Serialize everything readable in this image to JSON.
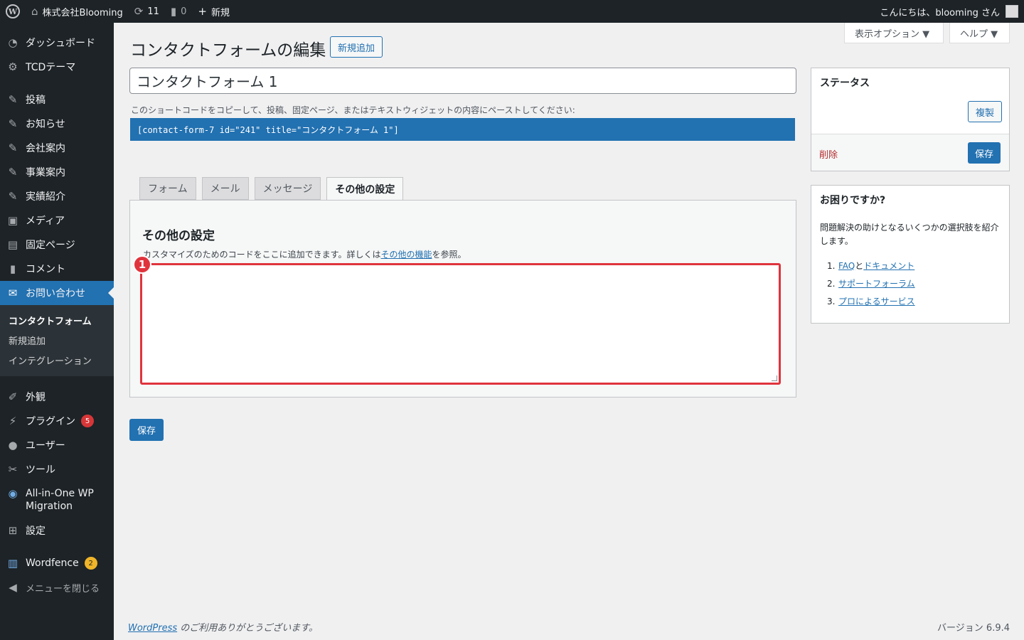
{
  "adminbar": {
    "site_name": "株式会社Blooming",
    "updates_count": "11",
    "comments_count": "0",
    "new_label": "新規",
    "greeting": "こんにちは、blooming さん"
  },
  "screen_options": {
    "display_options": "表示オプション ▼",
    "help": "ヘルプ ▼"
  },
  "sidebar": {
    "items": [
      {
        "label": "ダッシュボード",
        "icon": "dashboard-icon"
      },
      {
        "label": "TCDテーマ",
        "icon": "gear-icon"
      },
      {
        "label": "投稿",
        "icon": "pin-icon"
      },
      {
        "label": "お知らせ",
        "icon": "pin-icon"
      },
      {
        "label": "会社案内",
        "icon": "pin-icon"
      },
      {
        "label": "事業案内",
        "icon": "pin-icon"
      },
      {
        "label": "実績紹介",
        "icon": "pin-icon"
      },
      {
        "label": "メディア",
        "icon": "media-icon"
      },
      {
        "label": "固定ページ",
        "icon": "page-icon"
      },
      {
        "label": "コメント",
        "icon": "comment-icon"
      },
      {
        "label": "お問い合わせ",
        "icon": "mail-icon"
      }
    ],
    "submenu": [
      "コンタクトフォーム",
      "新規追加",
      "インテグレーション"
    ],
    "items2": [
      {
        "label": "外観",
        "icon": "brush-icon"
      },
      {
        "label": "プラグイン",
        "icon": "plugin-icon",
        "badge": "5"
      },
      {
        "label": "ユーザー",
        "icon": "user-icon"
      },
      {
        "label": "ツール",
        "icon": "wrench-icon"
      },
      {
        "label": "All-in-One WP Migration",
        "icon": "migration-icon"
      },
      {
        "label": "設定",
        "icon": "settings-icon"
      }
    ],
    "wordfence": {
      "label": "Wordfence",
      "badge": "2"
    },
    "collapse": "メニューを閉じる"
  },
  "main": {
    "page_title": "コンタクトフォームの編集",
    "add_new": "新規追加",
    "form_title": "コンタクトフォーム 1",
    "shortcode_desc": "このショートコードをコピーして、投稿、固定ページ、またはテキストウィジェットの内容にペーストしてください:",
    "shortcode": "[contact-form-7 id=\"241\" title=\"コンタクトフォーム 1\"]",
    "tabs": [
      "フォーム",
      "メール",
      "メッセージ",
      "その他の設定"
    ],
    "panel_title": "その他の設定",
    "panel_desc_before": "カスタマイズのためのコードをここに追加できます。詳しくは",
    "panel_desc_link": "その他の機能",
    "panel_desc_after": "を参照。",
    "marker": "1",
    "save": "保存"
  },
  "status_box": {
    "title": "ステータス",
    "duplicate": "複製",
    "delete": "削除",
    "save": "保存"
  },
  "help_box": {
    "title": "お困りですか?",
    "text": "問題解決の助けとなるいくつかの選択肢を紹介します。",
    "list": [
      {
        "num": "1.",
        "link1": "FAQ",
        "mid": "と",
        "link2": "ドキュメント"
      },
      {
        "num": "2.",
        "link1": "サポートフォーラム"
      },
      {
        "num": "3.",
        "link1": "プロによるサービス"
      }
    ]
  },
  "footer": {
    "wp_link": "WordPress",
    "thanks": " のご利用ありがとうございます。",
    "version": "バージョン 6.9.4"
  },
  "colors": {
    "accent": "#2271b1",
    "sidebar_bg": "#1d2327",
    "highlight_border": "#e0343d",
    "delete": "#b32d2e"
  }
}
